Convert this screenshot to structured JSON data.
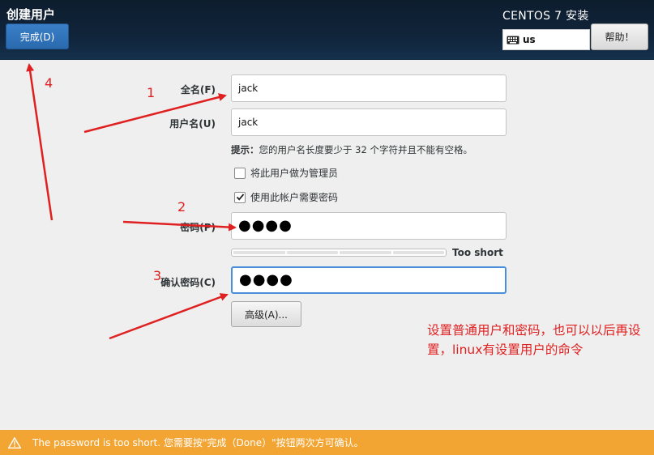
{
  "header": {
    "title": "创建用户",
    "done_label": "完成(D)",
    "install_title": "CENTOS 7 安装",
    "keyboard_layout": "us",
    "help_label": "帮助！"
  },
  "form": {
    "fullname_label": "全名(F)",
    "fullname_value": "jack",
    "username_label": "用户名(U)",
    "username_value": "jack",
    "hint_prefix": "提示：",
    "hint_text": "您的用户名长度要少于 32 个字符并且不能有空格。",
    "admin_checkbox_label": "将此用户做为管理员",
    "admin_checked": false,
    "require_password_label": "使用此帐户需要密码",
    "require_password_checked": true,
    "password_label": "密码(P)",
    "password_value": "●●●●",
    "strength_text": "Too short",
    "confirm_label": "确认密码(C)",
    "confirm_value": "●●●●",
    "advanced_label": "高级(A)..."
  },
  "annotations": {
    "num1": "1",
    "num2": "2",
    "num3": "3",
    "num4": "4",
    "note": "设置普通用户和密码，也可以以后再设置，linux有设置用户的命令"
  },
  "warning": {
    "text": "The password is too short. 您需要按\"完成（Done）\"按钮两次方可确认。"
  },
  "colors": {
    "header_bg": "#10243a",
    "accent_blue": "#2a6aae",
    "focus_blue": "#4a90d9",
    "warning_bg": "#f3a533",
    "annotation_red": "#e02020"
  }
}
